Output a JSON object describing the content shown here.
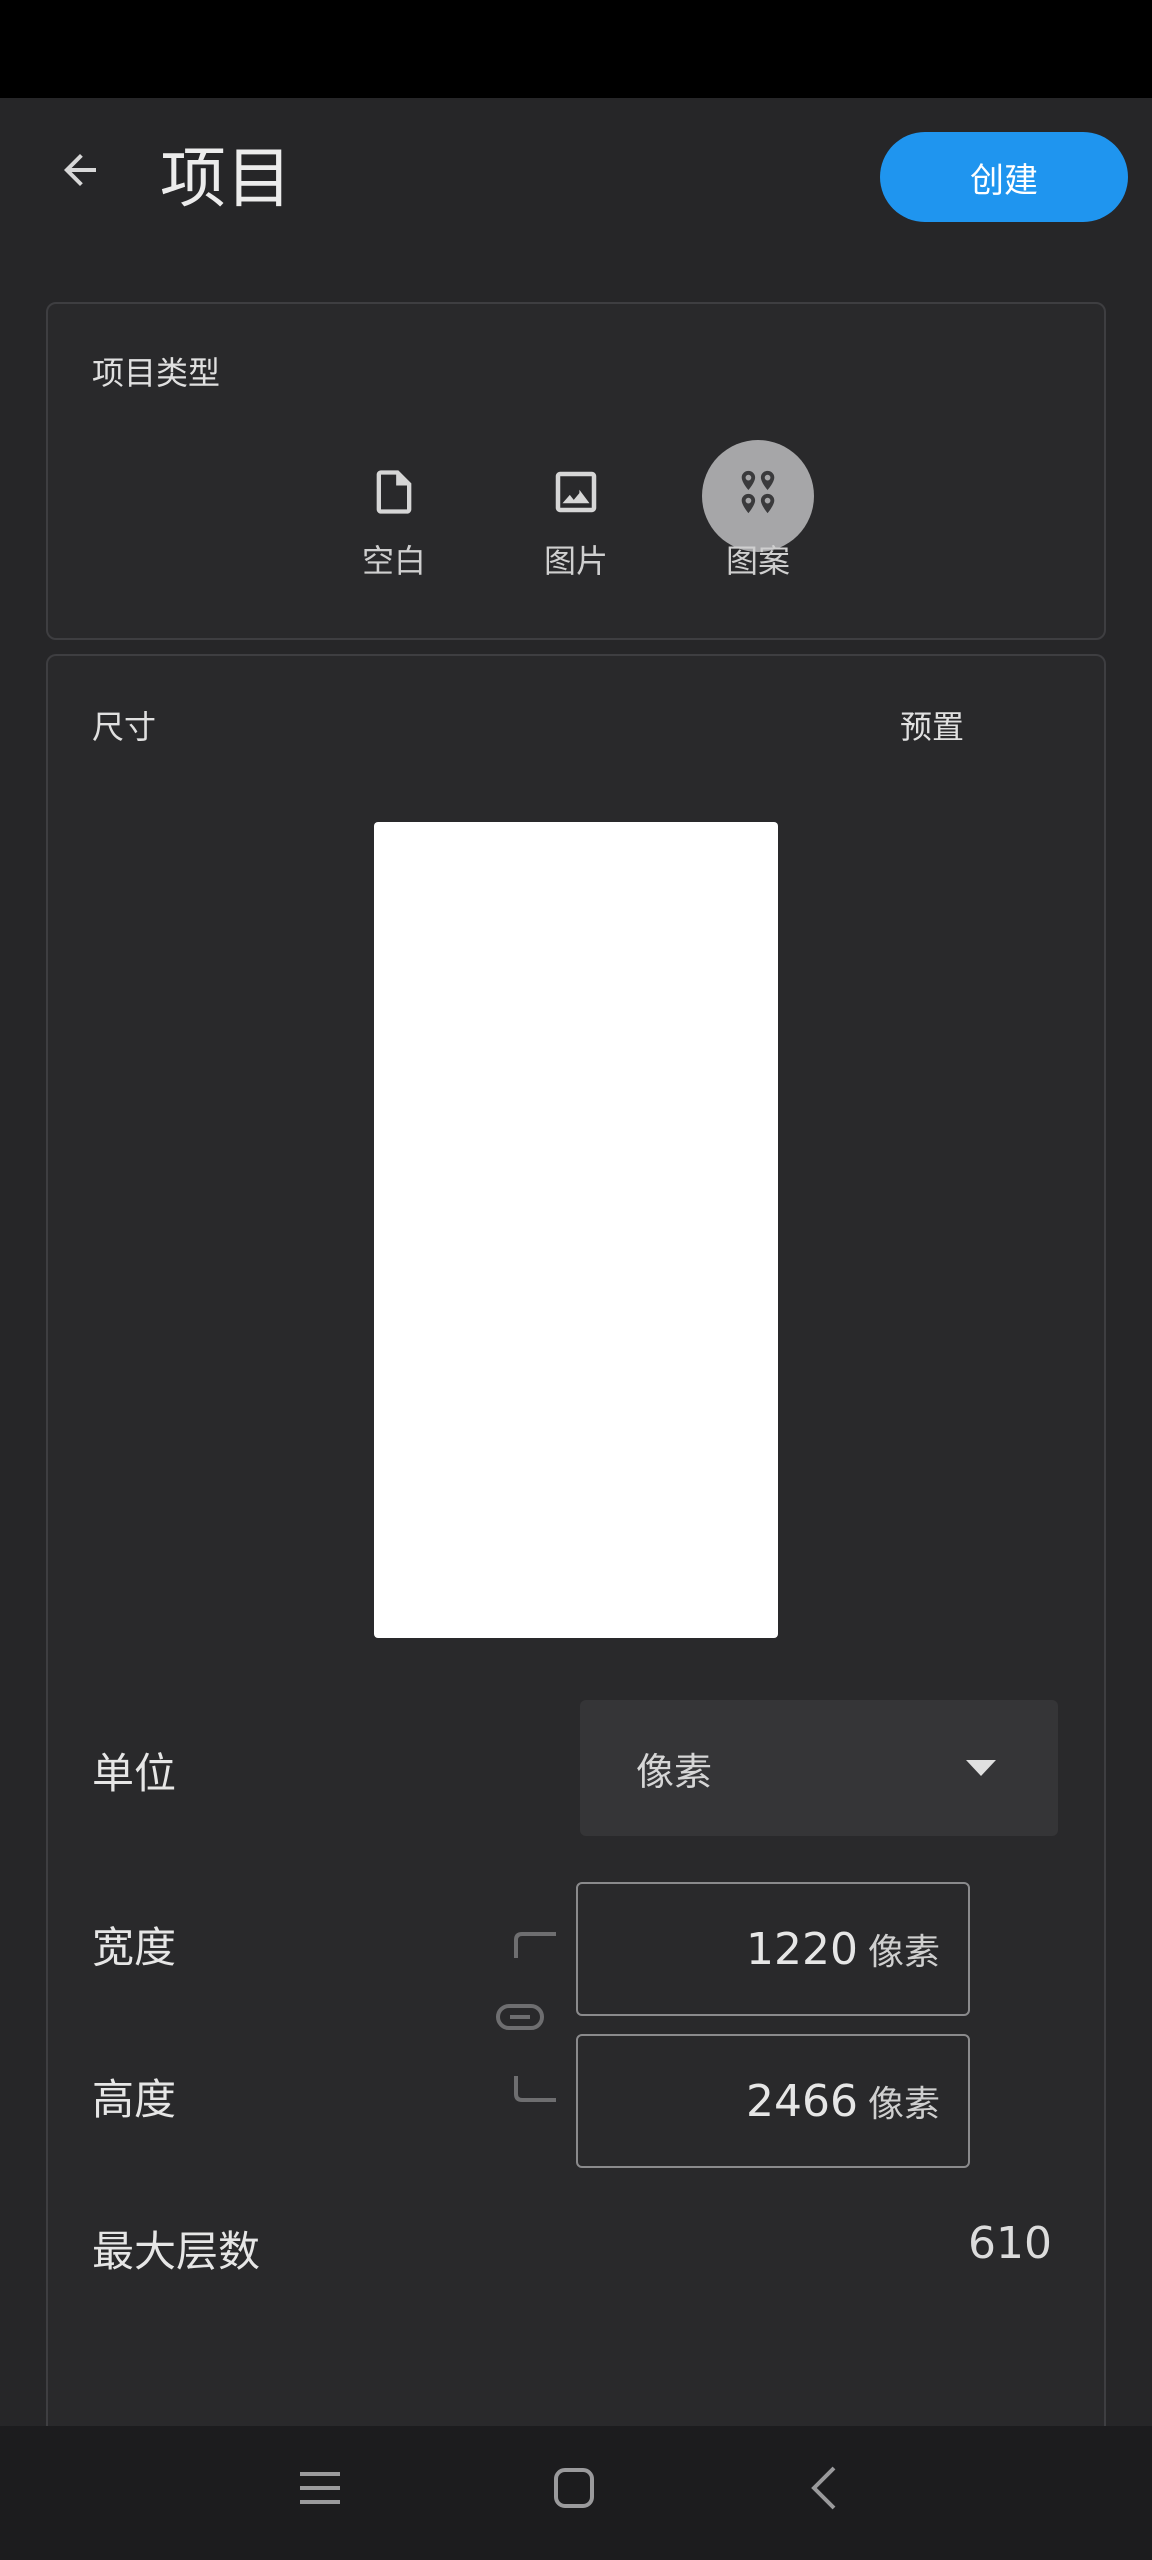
{
  "header": {
    "title": "项目",
    "create_label": "创建"
  },
  "project_type": {
    "title": "项目类型",
    "options": [
      {
        "label": "空白",
        "icon": "file-icon"
      },
      {
        "label": "图片",
        "icon": "image-icon"
      },
      {
        "label": "图案",
        "icon": "pattern-icon",
        "selected": true
      }
    ]
  },
  "size": {
    "title": "尺寸",
    "preset_label": "预置",
    "unit_label": "单位",
    "unit_value": "像素",
    "width_label": "宽度",
    "width_value": "1220",
    "width_unit": "像素",
    "height_label": "高度",
    "height_value": "2466",
    "height_unit": "像素",
    "max_layers_label": "最大层数",
    "max_layers_value": "610"
  },
  "colors": {
    "accent": "#1f95ef",
    "background": "#262628",
    "card": "#29292b",
    "preview": "#ffffff"
  }
}
